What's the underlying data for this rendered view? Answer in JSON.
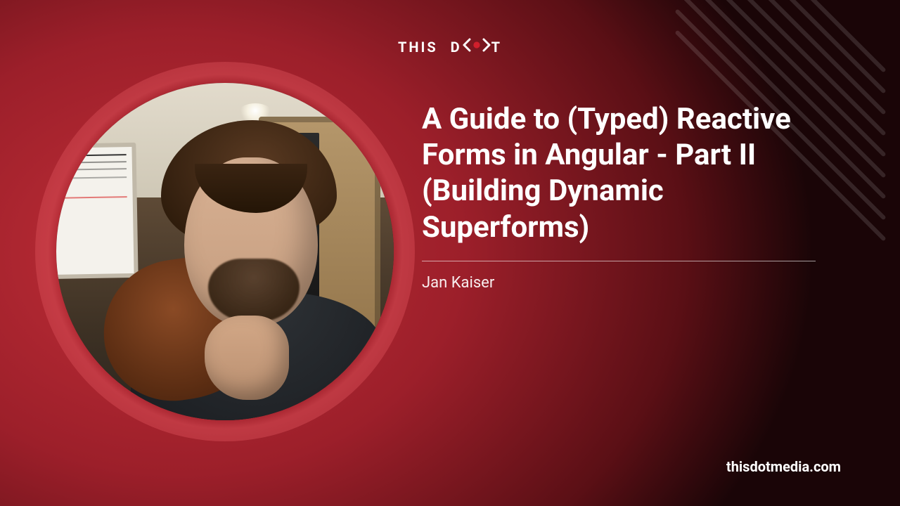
{
  "brand": {
    "word1": "THIS",
    "word2": "D",
    "word3": "T",
    "logo_name": "this-dot"
  },
  "hero": {
    "title": "A Guide to (Typed) Reactive Forms in Angular - Part II (Building Dynamic Superforms)",
    "author": "Jan Kaiser"
  },
  "site": "thisdotmedia.com",
  "colors": {
    "accent": "#BD2130",
    "text": "#FFFFFF"
  }
}
